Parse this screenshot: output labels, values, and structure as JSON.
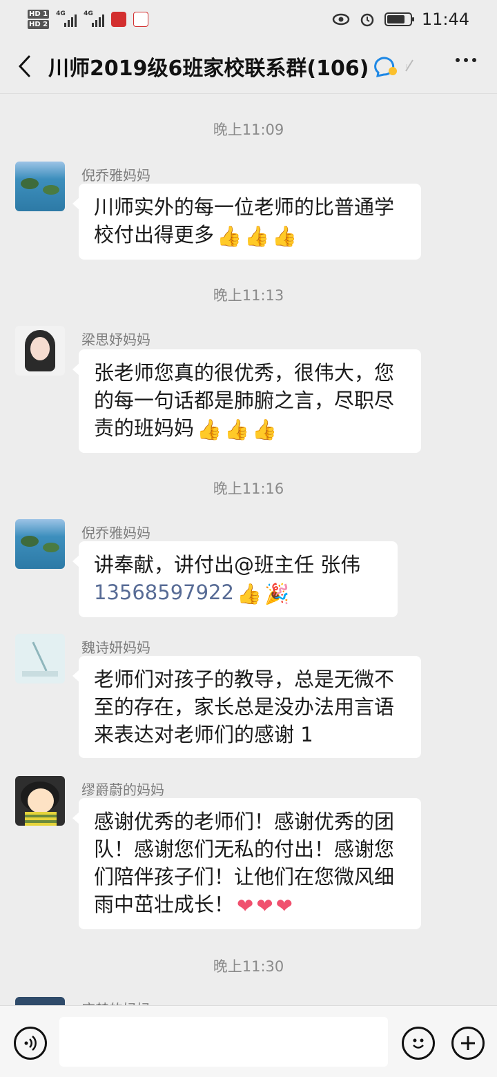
{
  "status_bar": {
    "sim1": "HD 1",
    "sim2": "HD 2",
    "network1": "4G",
    "network2": "4G",
    "time": "11:44"
  },
  "nav": {
    "title": "川师2019级6班家校联系群(106)"
  },
  "messages": [
    {
      "type": "time",
      "text": "晚上11:09"
    },
    {
      "type": "msg",
      "sender": "倪乔雅妈妈",
      "avatar": "island-photo",
      "text": "川师实外的每一位老师的比普通学校付出得更多",
      "emoji": [
        "thumbs-up",
        "thumbs-up",
        "thumbs-up"
      ]
    },
    {
      "type": "time",
      "text": "晚上11:13"
    },
    {
      "type": "msg",
      "sender": "梁思妤妈妈",
      "avatar": "girl-photo",
      "text": "张老师您真的很优秀，很伟大，您的每一句话都是肺腑之言，尽职尽责的班妈妈",
      "emoji": [
        "thumbs-up",
        "thumbs-up",
        "thumbs-up"
      ]
    },
    {
      "type": "time",
      "text": "晚上11:16"
    },
    {
      "type": "msg",
      "sender": "倪乔雅妈妈",
      "avatar": "island-photo",
      "text": "讲奉献，讲付出@班主任  张伟",
      "phone": "13568597922",
      "emoji": [
        "thumbs-up",
        "party-popper"
      ]
    },
    {
      "type": "msg",
      "sender": "魏诗妍妈妈",
      "avatar": "leaf-art",
      "text": "老师们对孩子的教导，总是无微不至的存在，家长总是没办法用言语来表达对老师们的感谢 1"
    },
    {
      "type": "msg",
      "sender": "缪爵蔚的妈妈",
      "avatar": "cartoon-girl",
      "text": "感谢优秀的老师们！感谢优秀的团队！感谢您们无私的付出！感谢您们陪伴孩子们！让他们在您微风细雨中茁壮成长！",
      "emoji": [
        "heart",
        "heart",
        "heart"
      ]
    },
    {
      "type": "time",
      "text": "晚上11:30"
    },
    {
      "type": "msg",
      "sender": "唐楚的妈妈",
      "avatar": "dark-photo",
      "text": ""
    }
  ],
  "input_bar": {
    "placeholder": ""
  },
  "colors": {
    "background": "#ededed",
    "bubble": "#ffffff",
    "link": "#576b95",
    "heart": "#f0506e"
  }
}
